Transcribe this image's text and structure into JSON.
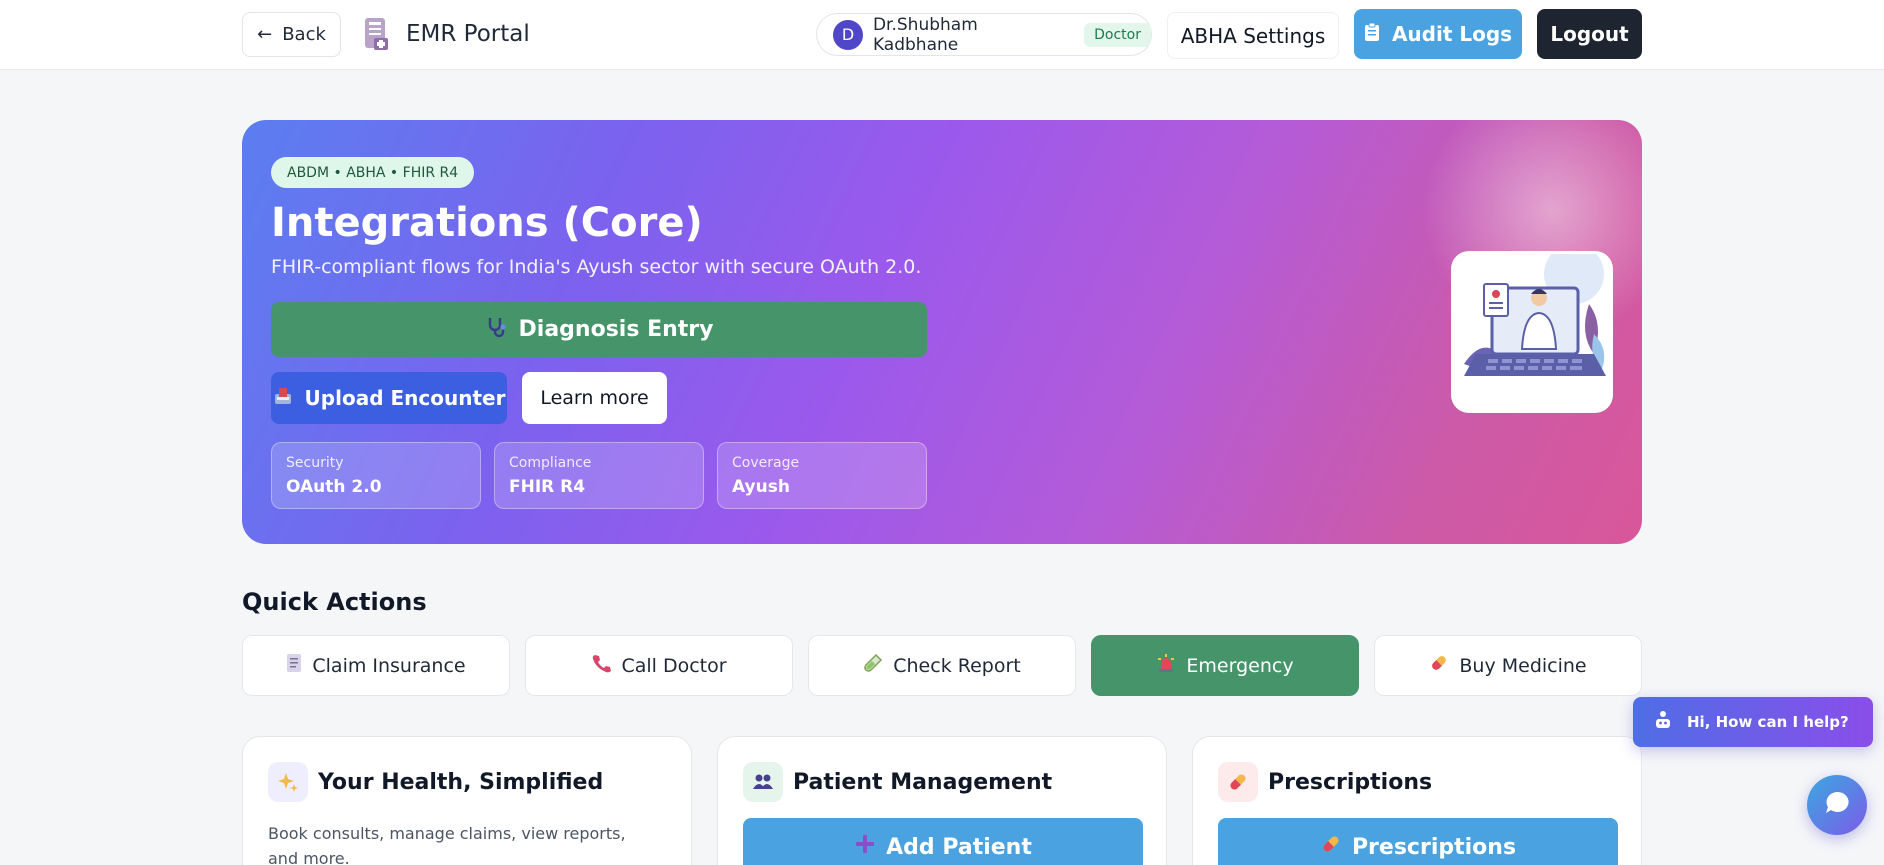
{
  "header": {
    "back_label": "Back",
    "app_title": "EMR Portal",
    "user": {
      "initial": "D",
      "name": "Dr.Shubham Kadbhane",
      "role": "Doctor"
    },
    "abha_settings_label": "ABHA Settings",
    "audit_logs_label": "Audit Logs",
    "logout_label": "Logout"
  },
  "hero": {
    "tags": "ABDM • ABHA • FHIR R4",
    "title": "Integrations (Core)",
    "subtitle": "FHIR-compliant flows for India's Ayush sector with secure OAuth 2.0.",
    "diagnosis_label": "Diagnosis Entry",
    "upload_label": "Upload Encounter",
    "learn_more_label": "Learn more",
    "stats": [
      {
        "label": "Security",
        "value": "OAuth 2.0"
      },
      {
        "label": "Compliance",
        "value": "FHIR R4"
      },
      {
        "label": "Coverage",
        "value": "Ayush"
      }
    ]
  },
  "quick_actions": {
    "title": "Quick Actions",
    "items": [
      {
        "label": "Claim Insurance",
        "icon": "document-icon"
      },
      {
        "label": "Call Doctor",
        "icon": "phone-icon"
      },
      {
        "label": "Check Report",
        "icon": "test-tube-icon"
      },
      {
        "label": "Emergency",
        "icon": "siren-icon",
        "active": true
      },
      {
        "label": "Buy Medicine",
        "icon": "pill-icon"
      }
    ]
  },
  "cards": [
    {
      "title": "Your Health, Simplified",
      "icon": "sparkles-icon",
      "text": "Book consults, manage claims, view reports, and more."
    },
    {
      "title": "Patient Management",
      "icon": "people-icon",
      "button": "Add Patient"
    },
    {
      "title": "Prescriptions",
      "icon": "pill-icon",
      "button": "Prescriptions"
    }
  ],
  "chat": {
    "prompt": "Hi, How can I help?"
  },
  "colors": {
    "primary_green": "#45946a",
    "primary_blue": "#4aa3e0",
    "upload_blue": "#3b5fe0",
    "logout_dark": "#1f2530"
  }
}
